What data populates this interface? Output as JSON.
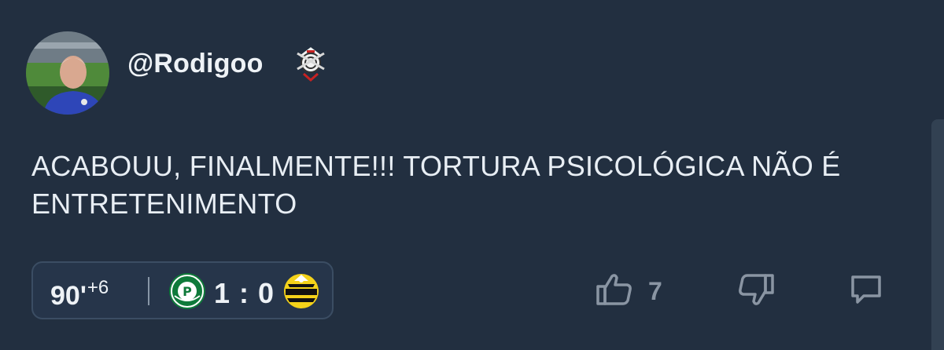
{
  "post": {
    "username": "@Rodigoo",
    "text": "ACABOUU, FINALMENTE!!! TORTURA PSICOLÓGICA NÃO É ENTRETENIMENTO",
    "badge_icon": "corinthians-crest-icon"
  },
  "match": {
    "minute": "90'",
    "added_time": "+6",
    "home_crest": "palmeiras-crest-icon",
    "score": "1 : 0",
    "away_crest": "novorizontino-crest-icon"
  },
  "actions": {
    "like_count": "7",
    "like_icon": "thumbs-up-icon",
    "dislike_icon": "thumbs-down-icon",
    "comment_icon": "comment-icon"
  },
  "colors": {
    "background": "#222f40",
    "pill_background": "#26354a",
    "muted_icon": "#8a95a3",
    "text": "#e8eef4"
  }
}
